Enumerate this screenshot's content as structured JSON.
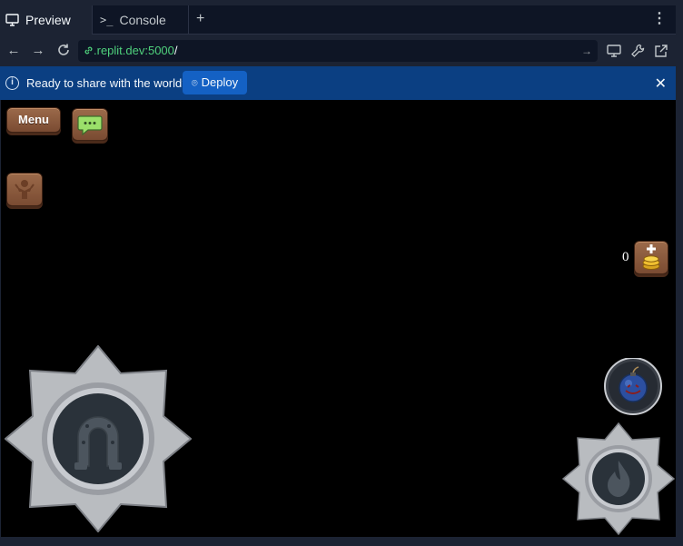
{
  "tabs": [
    {
      "label": "Preview",
      "icon": "monitor-icon",
      "active": true
    },
    {
      "label": "Console",
      "icon": "terminal-icon",
      "active": false
    }
  ],
  "tab_add_label": "+",
  "tab_more_label": "⋮",
  "address": {
    "host": ".replit.dev:5000",
    "path": "/"
  },
  "banner": {
    "message": "Ready to share with the world?",
    "deploy_label": "Deploy",
    "close_label": "✕"
  },
  "game": {
    "menu_label": "Menu",
    "coin_count": "0",
    "colors": {
      "wood": "#8b5a3c",
      "silver": "#b9bcc0",
      "dark_slate": "#2a323a",
      "chat_bubble": "#9be06a",
      "bomb": "#2c4fa0"
    }
  }
}
